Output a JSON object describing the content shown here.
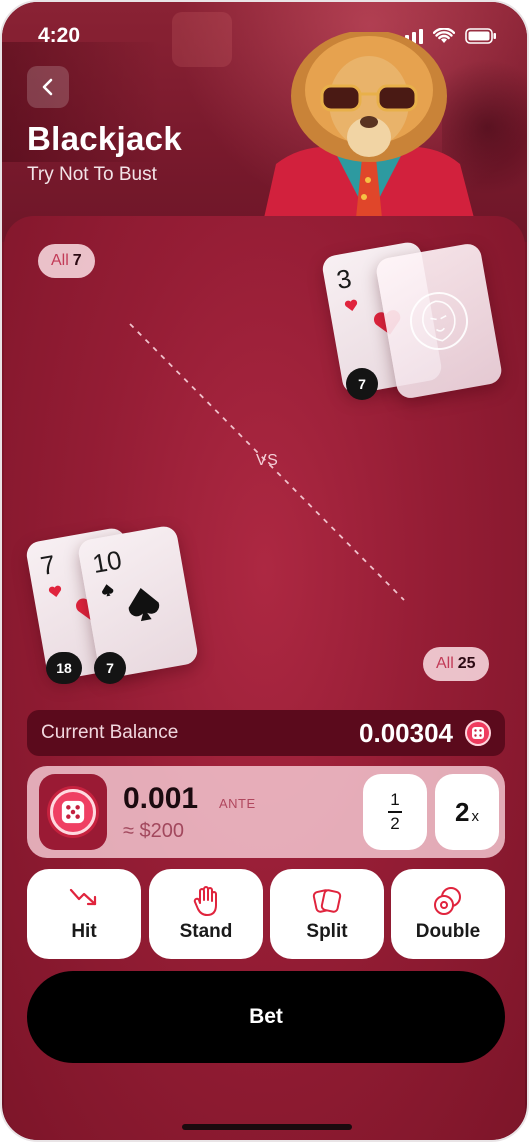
{
  "status": {
    "time": "4:20"
  },
  "header": {
    "title": "Blackjack",
    "subtitle": "Try Not To Bust",
    "back_icon": "chevron-left-icon"
  },
  "dealer": {
    "pill_label": "All",
    "pill_value": "7",
    "card_rank": "3",
    "card_suit": "hearts",
    "score": "7"
  },
  "vs_label": "VS",
  "player": {
    "pill_label": "All",
    "pill_value": "25",
    "cards": [
      {
        "rank": "7",
        "suit": "hearts"
      },
      {
        "rank": "10",
        "suit": "spades"
      }
    ],
    "scores": [
      "18",
      "7"
    ]
  },
  "balance": {
    "label": "Current Balance",
    "value": "0.00304"
  },
  "ante": {
    "value": "0.001",
    "label": "ANTE",
    "usd": "≈ $200",
    "half_top": "1",
    "half_bottom": "2",
    "double_value": "2",
    "double_suffix": "x"
  },
  "actions": [
    {
      "label": "Hit",
      "icon": "hit-arrow-icon"
    },
    {
      "label": "Stand",
      "icon": "hand-stop-icon"
    },
    {
      "label": "Split",
      "icon": "split-cards-icon"
    },
    {
      "label": "Double",
      "icon": "double-chip-icon"
    }
  ],
  "bet_label": "Bet",
  "colors": {
    "accent": "#ef3c5f",
    "background": "#951d35",
    "balance_bar": "#5b0a1c",
    "bet_button": "#000000"
  }
}
